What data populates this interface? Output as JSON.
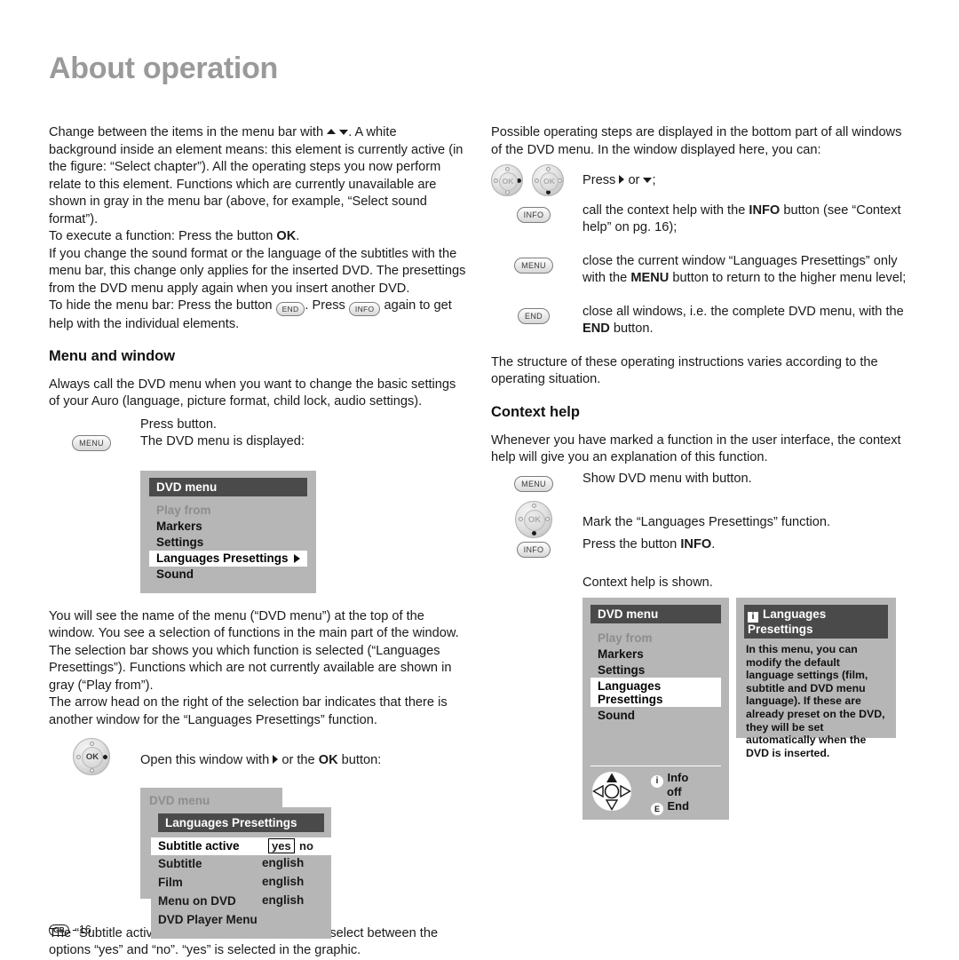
{
  "page": {
    "title": "About operation",
    "footer_locale": "GB",
    "footer_separator": "-",
    "footer_page": "16"
  },
  "left": {
    "intro_p1_a": "Change between the items in the menu bar with",
    "intro_p1_b": ". A white background inside an element means: this element is currently active (in the figure: “Select chapter”). All the operating steps you now perform relate to this element. Functions which are currently unavailable are shown in gray in the menu bar (above, for example, “Select sound format”).",
    "intro_p2_a": "To execute a function: Press the button",
    "intro_p2_ok": "OK",
    "intro_p2_b": ".",
    "intro_p3": "If you change the sound format or the language of the subtitles with the menu bar, this change only applies for the inserted DVD. The presettings from the DVD menu apply again when you insert another DVD.",
    "intro_p4_a": "To hide the menu bar: Press the button",
    "intro_p4_key_end": "END",
    "intro_p4_b": ". Press",
    "intro_p4_key_info": "INFO",
    "intro_p4_c": "again to get help with the individual elements.",
    "menu_window_heading": "Menu and window",
    "menu_window_p1": "Always call the DVD menu when you want to change the basic settings of your Auro (language, picture format, child lock, audio settings).",
    "step_menu_key": "MENU",
    "step_menu_line1": "Press button.",
    "step_menu_line2": "The DVD menu is displayed:",
    "figure1": {
      "title": "DVD menu",
      "items": [
        {
          "label": "Play from",
          "state": "dim"
        },
        {
          "label": "Markers",
          "state": "normal"
        },
        {
          "label": "Settings",
          "state": "normal"
        },
        {
          "label": "Languages Presettings",
          "state": "selected",
          "arrow": true
        },
        {
          "label": "Sound",
          "state": "normal"
        }
      ]
    },
    "after_fig1_p1": "You will see the name of the menu (“DVD menu”) at the top of the window. You see a selection of functions in the main part of the window. The selection bar shows you which function is selected (“Languages Presettings”). Functions which are not currently available are shown in gray (“Play from”).",
    "after_fig1_p2": "The arrow head on the right of the selection bar indicates that there is another window for the “Languages Presettings” function.",
    "step_ok_label": "OK",
    "step_ok_text_a": "Open this window with",
    "step_ok_text_b": "or the",
    "step_ok_text_ok": "OK",
    "step_ok_text_c": "button:",
    "figure2": {
      "back_title": "DVD menu",
      "title": "Languages Presettings",
      "rows": [
        {
          "label": "Subtitle active",
          "value": "",
          "options": [
            "yes",
            "no"
          ],
          "selected_option": "yes",
          "highlight": true
        },
        {
          "label": "Subtitle",
          "value": "english"
        },
        {
          "label": "Film",
          "value": "english"
        },
        {
          "label": "Menu on DVD",
          "value": "english"
        },
        {
          "label": "DVD Player Menu",
          "value": ""
        }
      ]
    },
    "after_fig2": "The “Subtitle active” function is marked. You can select between the options “yes” and “no”. “yes” is selected in the graphic."
  },
  "right": {
    "p1": "Possible operating steps are displayed in the bottom part of all windows of the DVD menu. In the window displayed here, you can:",
    "step_press_a": "Press",
    "step_press_b": "or",
    "step_press_c": ";",
    "step_info_key": "INFO",
    "step_info_a": "call the context help with the",
    "step_info_bold": "INFO",
    "step_info_b": "button (see “Context help” on pg. 16);",
    "step_menu_key": "MENU",
    "step_menu_a": "close the current window “Languages Presettings” only with the",
    "step_menu_bold": "MENU",
    "step_menu_b": "button to return to the higher menu level;",
    "step_end_key": "END",
    "step_end_a": "close all windows, i.e. the complete DVD menu, with the",
    "step_end_bold": "END",
    "step_end_b": "button.",
    "p2": "The structure of these operating instructions varies according to the operating situation.",
    "context_help_heading": "Context help",
    "p3": "Whenever you have marked a function in the user interface, the context help will give you an explanation of this function.",
    "step_ch_menu_key": "MENU",
    "step_ch_menu_text": "Show DVD menu with button.",
    "step_ch_nav_text": "Mark the “Languages Presettings” function.",
    "step_ch_info_key": "INFO",
    "step_ch_info_a": "Press the button",
    "step_ch_info_bold": "INFO",
    "step_ch_info_b": ".",
    "step_ch_result": "Context help is shown.",
    "figure3": {
      "title": "DVD menu",
      "items": [
        {
          "label": "Play from",
          "state": "dim"
        },
        {
          "label": "Markers",
          "state": "normal"
        },
        {
          "label": "Settings",
          "state": "normal"
        },
        {
          "label": "Languages Presettings",
          "state": "selected"
        },
        {
          "label": "Sound",
          "state": "normal"
        }
      ],
      "legend": [
        {
          "badge": "i",
          "label": "Info"
        },
        {
          "badge": "",
          "label": "off"
        },
        {
          "badge": "E",
          "label": "End"
        }
      ]
    },
    "figure4": {
      "badge": "i",
      "title": "Languages Presettings",
      "body": "In this menu, you can modify the default language settings (film, subtitle and DVD menu language). If these are already preset on the DVD, they will be set automatically when the DVD is inserted."
    }
  },
  "colors": {
    "heading_gray": "#9a9a9a",
    "osd_background": "#b6b6b6",
    "osd_titlebar": "#4a4a4a",
    "osd_dim_text": "#8d8d8d",
    "text": "#1a1a1a"
  }
}
